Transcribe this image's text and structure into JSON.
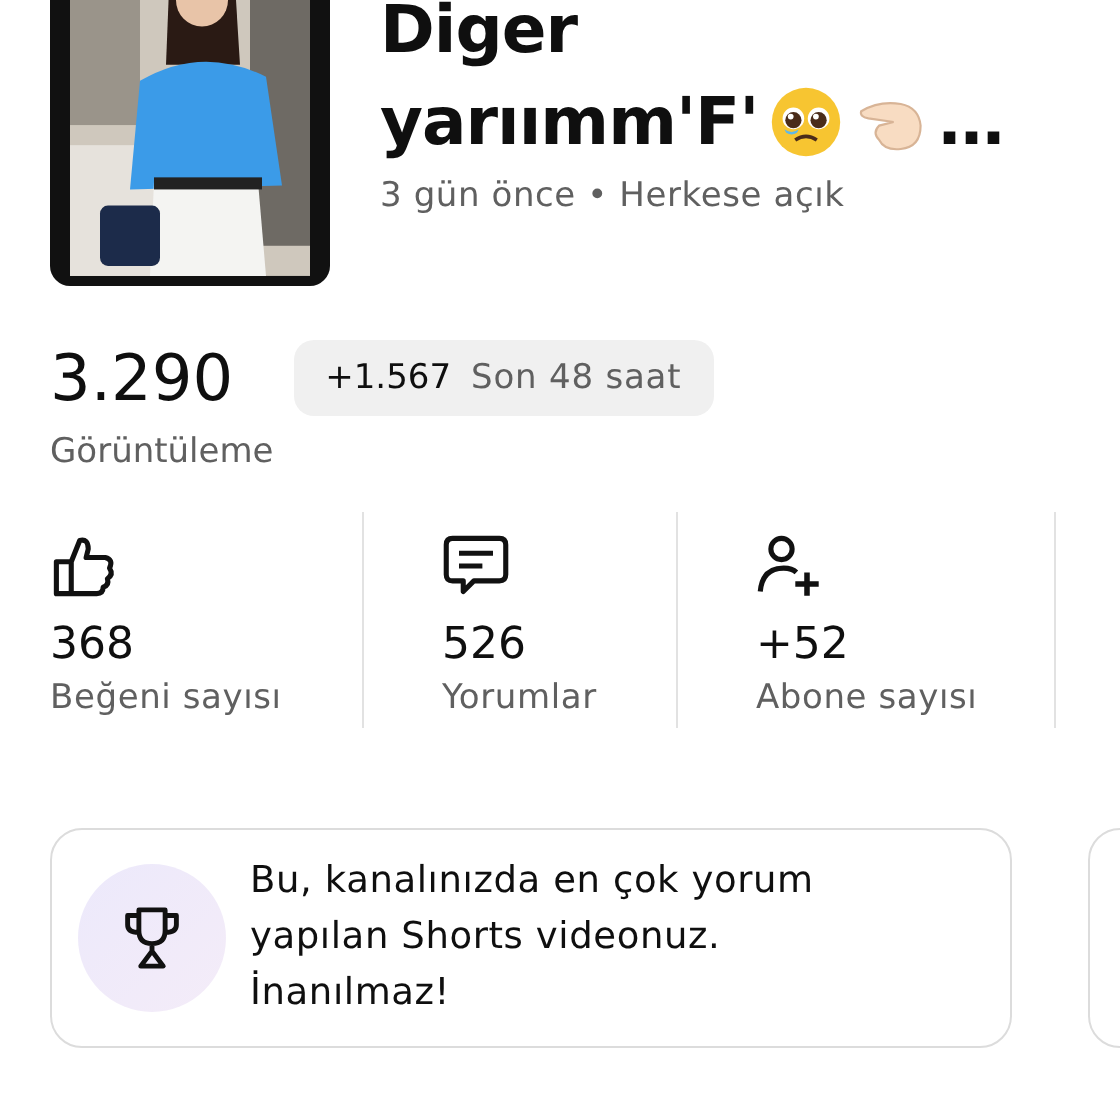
{
  "video": {
    "thumbnail": {
      "kind": "picture"
    },
    "title_lines": [
      "Diger",
      "yarıımm'F'"
    ],
    "title_end": "…",
    "meta": "3 gün önce • Herkese açık"
  },
  "views": {
    "count": "3.290",
    "delta": "+1.567",
    "period": "Son 48 saat",
    "label": "Görüntüleme"
  },
  "metrics": [
    {
      "kind": "likes",
      "value": "368",
      "label": "Beğeni sayısı"
    },
    {
      "kind": "comments",
      "value": "526",
      "label": "Yorumlar"
    },
    {
      "kind": "subscribers",
      "value": "+52",
      "label": "Abone sayısı"
    }
  ],
  "highlight": {
    "text": "Bu, kanalınızda en çok yorum yapılan Shorts videonuz. İnanılmaz!"
  }
}
